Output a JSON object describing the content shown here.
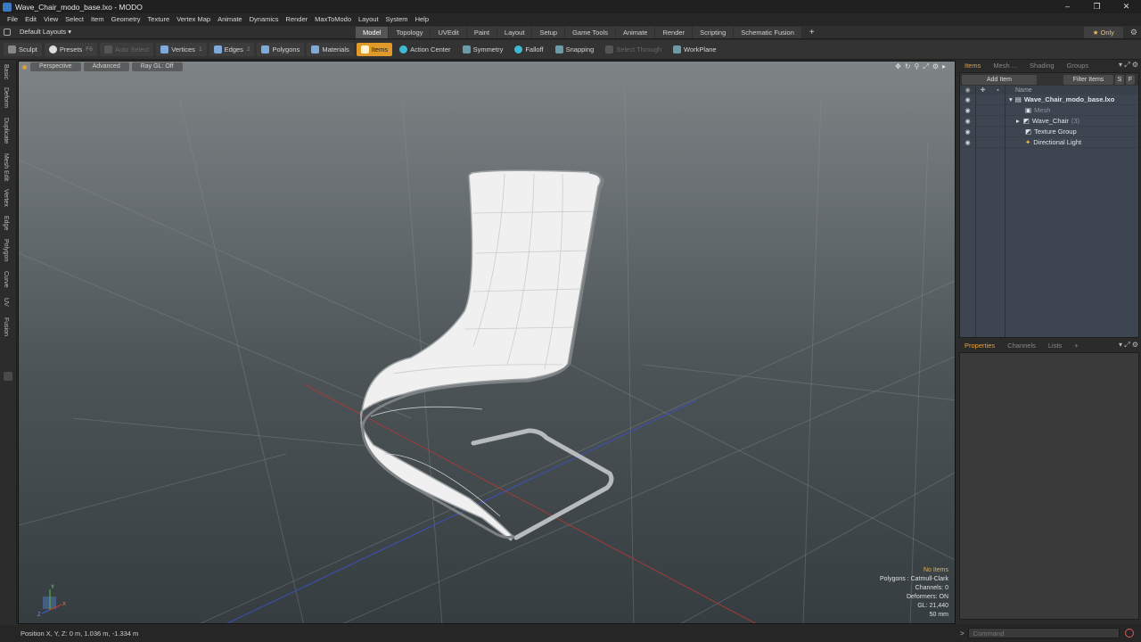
{
  "window": {
    "title": "Wave_Chair_modo_base.lxo - MODO",
    "controls": [
      "–",
      "❐",
      "✕"
    ]
  },
  "menu": [
    "File",
    "Edit",
    "View",
    "Select",
    "Item",
    "Geometry",
    "Texture",
    "Vertex Map",
    "Animate",
    "Dynamics",
    "Render",
    "MaxToModo",
    "Layout",
    "System",
    "Help"
  ],
  "layout_bar": {
    "layout_dropdown": "Default Layouts ▾",
    "tabs": [
      "Model",
      "Topology",
      "UVEdit",
      "Paint",
      "Layout",
      "Setup",
      "Game Tools",
      "Animate",
      "Render",
      "Scripting",
      "Schematic Fusion"
    ],
    "active_tab": "Model",
    "add_tab": "+",
    "only_label": "★ Only"
  },
  "toolbar": {
    "sculpt": "Sculpt",
    "presets": "Presets",
    "presets_hotkey": "F6",
    "auto_select": "Auto Select",
    "vertices": "Vertices",
    "vertices_hotkey": "1",
    "edges": "Edges",
    "edges_hotkey": "2",
    "polygons": "Polygons",
    "materials": "Materials",
    "items": "Items",
    "action_center": "Action Center",
    "symmetry": "Symmetry",
    "falloff": "Falloff",
    "snapping": "Snapping",
    "select_through": "Select Through",
    "workplane": "WorkPlane"
  },
  "left_tabs": [
    "Basic",
    "Deform",
    "Duplicate",
    "Mesh Edit",
    "Vertex",
    "Edge",
    "Polygon",
    "Curve",
    "UV",
    "Fusion"
  ],
  "viewport": {
    "view_mode": "Perspective",
    "shading": "Advanced",
    "raygl": "Ray GL: Off",
    "stats": [
      "No Items",
      "Polygons : Catmull-Clark",
      "Channels: 0",
      "Deformers: ON",
      "GL: 21,440",
      "50 mm"
    ],
    "axis_labels": {
      "y": "Y",
      "x": "X",
      "z": "Z"
    }
  },
  "status": {
    "position": "Position X, Y, Z:   0 m, 1.036 m, -1.334 m"
  },
  "items_panel": {
    "tabs": [
      "Items",
      "Mesh ...",
      "Shading",
      "Groups"
    ],
    "active_tab": "Items",
    "add_item": "Add Item",
    "filter_items": "Filter Items",
    "btn_s": "S",
    "btn_f": "F",
    "name_header": "Name",
    "rows": [
      {
        "label": "Wave_Chair_modo_base.lxo",
        "badge": ""
      },
      {
        "label": "Mesh",
        "badge": ""
      },
      {
        "label": "Wave_Chair",
        "badge": "(3)"
      },
      {
        "label": "Texture Group",
        "badge": ""
      },
      {
        "label": "Directional Light",
        "badge": ""
      }
    ]
  },
  "properties_panel": {
    "tabs": [
      "Properties",
      "Channels",
      "Lists",
      "+"
    ],
    "active_tab": "Properties"
  },
  "command": {
    "placeholder": "Command"
  }
}
